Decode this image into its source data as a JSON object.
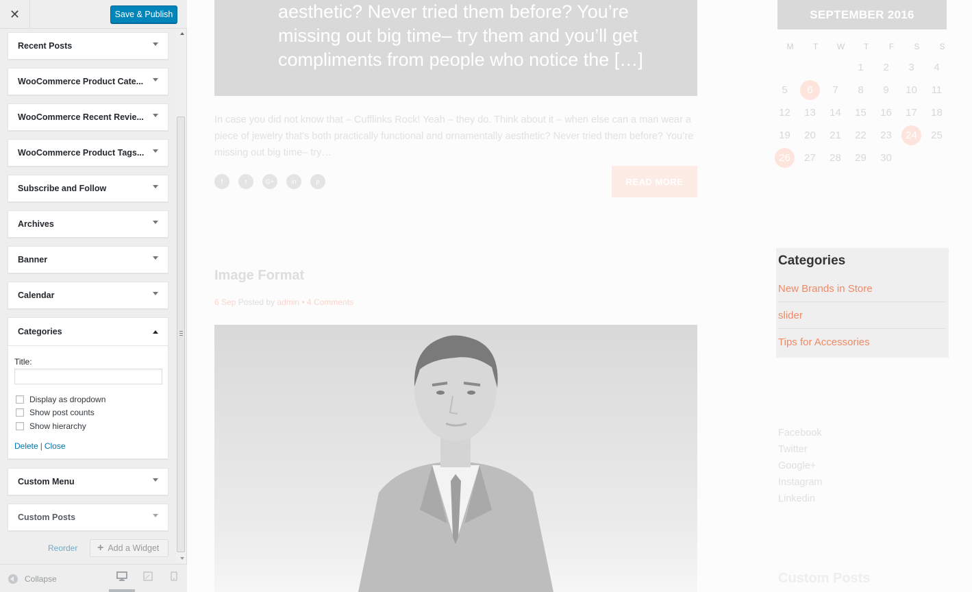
{
  "customizer": {
    "close_glyph": "✕",
    "publish_label": "Save & Publish",
    "widgets": [
      {
        "title": "Recent Posts"
      },
      {
        "title": "WooCommerce Product Cate..."
      },
      {
        "title": "WooCommerce Recent Revie..."
      },
      {
        "title": "WooCommerce Product Tags..."
      },
      {
        "title": "Subscribe and Follow"
      },
      {
        "title": "Archives"
      },
      {
        "title": "Banner"
      },
      {
        "title": "Calendar"
      }
    ],
    "open_widget": {
      "title": "Categories",
      "title_field_label": "Title:",
      "title_field_value": "",
      "options": [
        {
          "label": "Display as dropdown",
          "checked": false
        },
        {
          "label": "Show post counts",
          "checked": false
        },
        {
          "label": "Show hierarchy",
          "checked": false
        }
      ],
      "delete_label": "Delete",
      "separator": "|",
      "close_label": "Close"
    },
    "widgets_after": [
      {
        "title": "Custom Menu"
      },
      {
        "title": "Custom Posts"
      }
    ],
    "reorder_label": "Reorder",
    "add_widget_label": "Add a Widget",
    "add_widget_glyph": "+",
    "collapse_label": "Collapse",
    "devices": [
      "desktop-icon",
      "tablet-icon",
      "mobile-icon"
    ],
    "active_device": "desktop"
  },
  "preview": {
    "excerpt_box_text": "aesthetic? Never tried them before? You’re missing out big time– try them and you’ll get compliments from people who notice the […]",
    "post_excerpt": "In case you did not know that  – Cufflinks Rock! Yeah – they do. Think about it – when else can a man wear a piece of jewelry that’s both practically functional and ornamentally aesthetic? Never tried them before? You’re missing out big time– try…",
    "share_icons": [
      {
        "icon": "facebook-icon",
        "glyph": "f"
      },
      {
        "icon": "twitter-icon",
        "glyph": "t"
      },
      {
        "icon": "google-plus-icon",
        "glyph": "G+"
      },
      {
        "icon": "linkedin-icon",
        "glyph": "in"
      },
      {
        "icon": "pinterest-icon",
        "glyph": "p"
      }
    ],
    "read_more_label": "READ MORE",
    "post2": {
      "title": "Image Format",
      "date": "6 Sep",
      "posted_by": "Posted by",
      "author": "admin",
      "dot": "•",
      "comments": "4 Comments"
    },
    "calendar": {
      "heading": "SEPTEMBER 2016",
      "weekdays": [
        "M",
        "T",
        "W",
        "T",
        "F",
        "S",
        "S"
      ],
      "weeks": [
        [
          "",
          "",
          "",
          "1",
          "2",
          "3",
          "4"
        ],
        [
          "5",
          "6",
          "7",
          "8",
          "9",
          "10",
          "11"
        ],
        [
          "12",
          "13",
          "14",
          "15",
          "16",
          "17",
          "18"
        ],
        [
          "19",
          "20",
          "21",
          "22",
          "23",
          "24",
          "25"
        ],
        [
          "26",
          "27",
          "28",
          "29",
          "30",
          "",
          ""
        ]
      ],
      "highlighted": [
        "6",
        "24",
        "26"
      ]
    },
    "categories_widget": {
      "title": "Categories",
      "items": [
        "New Brands in Store",
        "slider",
        "Tips for Accessories"
      ]
    },
    "social_links": [
      "Facebook",
      "Twitter",
      "Google+",
      "Instagram",
      "Linkedin"
    ],
    "custom_posts_heading": "Custom Posts"
  },
  "colors": {
    "primary_button": "#0085ba",
    "link": "#0073aa",
    "accent": "#f08965"
  }
}
